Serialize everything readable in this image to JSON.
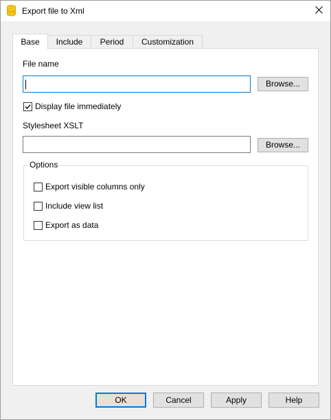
{
  "window": {
    "title": "Export file to Xml"
  },
  "tabs": [
    {
      "label": "Base",
      "active": true
    },
    {
      "label": "Include",
      "active": false
    },
    {
      "label": "Period",
      "active": false
    },
    {
      "label": "Customization",
      "active": false
    }
  ],
  "base": {
    "file_name_label": "File name",
    "file_name_value": "",
    "browse_label": "Browse...",
    "display_immediately_label": "Display file immediately",
    "display_immediately_checked": true,
    "stylesheet_label": "Stylesheet XSLT",
    "stylesheet_value": "",
    "stylesheet_browse_label": "Browse...",
    "options": {
      "title": "Options",
      "items": [
        {
          "label": "Export visible columns only",
          "checked": false
        },
        {
          "label": "Include view list",
          "checked": false
        },
        {
          "label": "Export as data",
          "checked": false
        }
      ]
    }
  },
  "footer": {
    "ok_label": "OK",
    "cancel_label": "Cancel",
    "apply_label": "Apply",
    "help_label": "Help"
  },
  "colors": {
    "accent": "#0078d7",
    "app_icon": "#f5c518"
  },
  "icons": {
    "app": "database-icon",
    "close": "close-icon",
    "check": "checkmark-icon"
  }
}
